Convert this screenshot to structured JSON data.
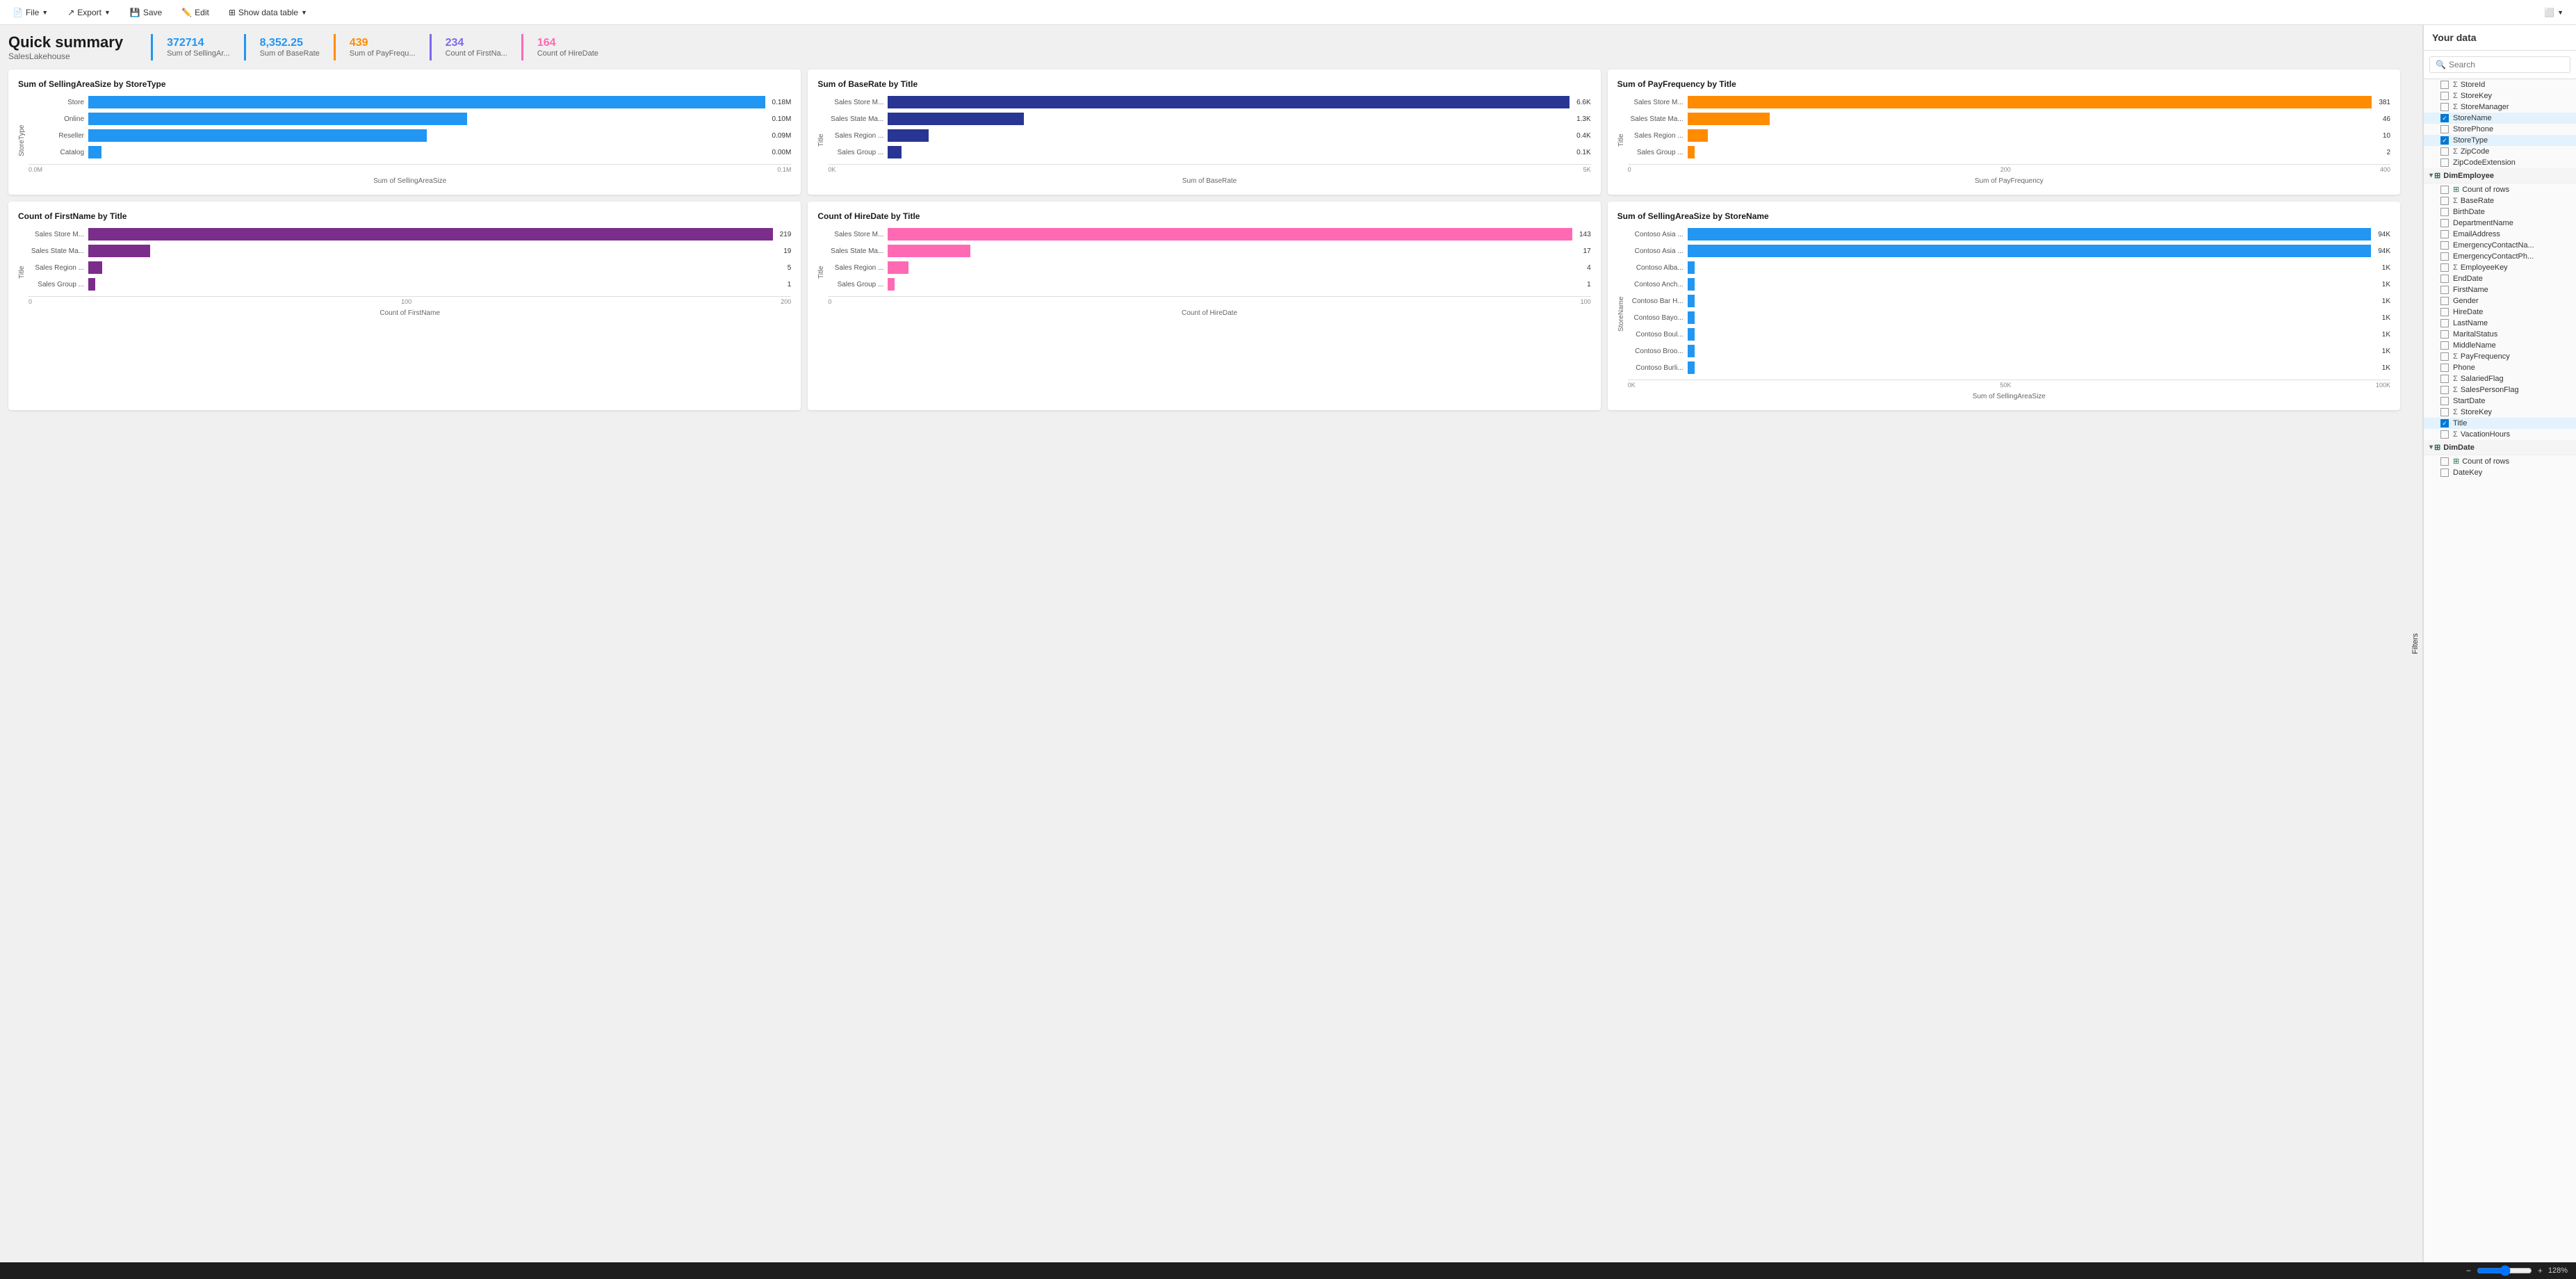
{
  "toolbar": {
    "file_label": "File",
    "export_label": "Export",
    "save_label": "Save",
    "edit_label": "Edit",
    "show_data_table_label": "Show data table"
  },
  "header": {
    "title": "Quick summary",
    "subtitle": "SalesLakehouse"
  },
  "summary_cards": [
    {
      "value": "372714",
      "label": "Sum of SellingAr...",
      "color": "#2196F3"
    },
    {
      "value": "8,352.25",
      "label": "Sum of BaseRate",
      "color": "#2196F3"
    },
    {
      "value": "439",
      "label": "Sum of PayFrequ...",
      "color": "#FF8C00"
    },
    {
      "value": "234",
      "label": "Count of FirstNa...",
      "color": "#7B68EE"
    },
    {
      "value": "164",
      "label": "Count of HireDate",
      "color": "#FF69B4"
    }
  ],
  "charts": [
    {
      "id": "chart1",
      "title": "Sum of SellingAreaSize by StoreType",
      "y_axis": "StoreType",
      "x_axis": "Sum of SellingAreaSize",
      "color": "#2196F3",
      "bars": [
        {
          "label": "Store",
          "value": "0.18M",
          "width_pct": 100
        },
        {
          "label": "Online",
          "value": "0.10M",
          "width_pct": 56
        },
        {
          "label": "Reseller",
          "value": "0.09M",
          "width_pct": 50
        },
        {
          "label": "Catalog",
          "value": "0.00M",
          "width_pct": 2
        }
      ],
      "x_ticks": [
        "0.0M",
        "0.1M"
      ]
    },
    {
      "id": "chart2",
      "title": "Sum of BaseRate by Title",
      "y_axis": "Title",
      "x_axis": "Sum of BaseRate",
      "color": "#283593",
      "bars": [
        {
          "label": "Sales Store M...",
          "value": "6.6K",
          "width_pct": 100
        },
        {
          "label": "Sales State Ma...",
          "value": "1.3K",
          "width_pct": 20
        },
        {
          "label": "Sales Region ...",
          "value": "0.4K",
          "width_pct": 6
        },
        {
          "label": "Sales Group ...",
          "value": "0.1K",
          "width_pct": 2
        }
      ],
      "x_ticks": [
        "0K",
        "5K"
      ]
    },
    {
      "id": "chart3",
      "title": "Sum of PayFrequency by Title",
      "y_axis": "Title",
      "x_axis": "Sum of PayFrequency",
      "color": "#FF8C00",
      "bars": [
        {
          "label": "Sales Store M...",
          "value": "381",
          "width_pct": 100
        },
        {
          "label": "Sales State Ma...",
          "value": "46",
          "width_pct": 12
        },
        {
          "label": "Sales Region ...",
          "value": "10",
          "width_pct": 3
        },
        {
          "label": "Sales Group ...",
          "value": "2",
          "width_pct": 1
        }
      ],
      "x_ticks": [
        "0",
        "200",
        "400"
      ]
    },
    {
      "id": "chart4",
      "title": "Count of FirstName by Title",
      "y_axis": "Title",
      "x_axis": "Count of FirstName",
      "color": "#7B2D8B",
      "bars": [
        {
          "label": "Sales Store M...",
          "value": "219",
          "width_pct": 100
        },
        {
          "label": "Sales State Ma...",
          "value": "19",
          "width_pct": 9
        },
        {
          "label": "Sales Region ...",
          "value": "5",
          "width_pct": 2
        },
        {
          "label": "Sales Group ...",
          "value": "1",
          "width_pct": 0.5
        }
      ],
      "x_ticks": [
        "0",
        "100",
        "200"
      ]
    },
    {
      "id": "chart5",
      "title": "Count of HireDate by Title",
      "y_axis": "Title",
      "x_axis": "Count of HireDate",
      "color": "#FF69B4",
      "bars": [
        {
          "label": "Sales Store M...",
          "value": "143",
          "width_pct": 100
        },
        {
          "label": "Sales State Ma...",
          "value": "17",
          "width_pct": 12
        },
        {
          "label": "Sales Region ...",
          "value": "4",
          "width_pct": 3
        },
        {
          "label": "Sales Group ...",
          "value": "1",
          "width_pct": 0.7
        }
      ],
      "x_ticks": [
        "0",
        "100"
      ]
    },
    {
      "id": "chart6",
      "title": "Sum of SellingAreaSize by StoreName",
      "y_axis": "StoreName",
      "x_axis": "Sum of SellingAreaSize",
      "color": "#2196F3",
      "bars": [
        {
          "label": "Contoso Asia ...",
          "value": "94K",
          "width_pct": 100
        },
        {
          "label": "Contoso Asia ...",
          "value": "94K",
          "width_pct": 100
        },
        {
          "label": "Contoso Alba...",
          "value": "1K",
          "width_pct": 1
        },
        {
          "label": "Contoso Anch...",
          "value": "1K",
          "width_pct": 1
        },
        {
          "label": "Contoso Bar H...",
          "value": "1K",
          "width_pct": 1
        },
        {
          "label": "Contoso Bayo...",
          "value": "1K",
          "width_pct": 1
        },
        {
          "label": "Contoso Boul...",
          "value": "1K",
          "width_pct": 1
        },
        {
          "label": "Contoso Broo...",
          "value": "1K",
          "width_pct": 1
        },
        {
          "label": "Contoso Burli...",
          "value": "1K",
          "width_pct": 1
        }
      ],
      "x_ticks": [
        "0K",
        "50K",
        "100K"
      ]
    }
  ],
  "right_panel": {
    "title": "Your data",
    "search_placeholder": "Search",
    "filters_label": "Filters",
    "tree_items": [
      {
        "type": "item",
        "text": "StoreId",
        "icon": "sigma",
        "indent": 1,
        "checked": false
      },
      {
        "type": "item",
        "text": "StoreKey",
        "icon": "sigma",
        "indent": 1,
        "checked": false
      },
      {
        "type": "item",
        "text": "StoreManager",
        "icon": "sigma",
        "indent": 1,
        "checked": false
      },
      {
        "type": "item",
        "text": "StoreName",
        "icon": "",
        "indent": 1,
        "checked": true,
        "selected": true
      },
      {
        "type": "item",
        "text": "StorePhone",
        "icon": "",
        "indent": 1,
        "checked": false
      },
      {
        "type": "item",
        "text": "StoreType",
        "icon": "",
        "indent": 1,
        "checked": true,
        "selected": true
      },
      {
        "type": "item",
        "text": "ZipCode",
        "icon": "sigma",
        "indent": 1,
        "checked": false
      },
      {
        "type": "item",
        "text": "ZipCodeExtension",
        "icon": "",
        "indent": 1,
        "checked": false
      },
      {
        "type": "section",
        "text": "DimEmployee",
        "indent": 0,
        "expanded": true
      },
      {
        "type": "item",
        "text": "Count of rows",
        "icon": "table",
        "indent": 1,
        "checked": false
      },
      {
        "type": "item",
        "text": "BaseRate",
        "icon": "sigma",
        "indent": 1,
        "checked": false
      },
      {
        "type": "item",
        "text": "BirthDate",
        "icon": "",
        "indent": 1,
        "checked": false
      },
      {
        "type": "item",
        "text": "DepartmentName",
        "icon": "",
        "indent": 1,
        "checked": false
      },
      {
        "type": "item",
        "text": "EmailAddress",
        "icon": "",
        "indent": 1,
        "checked": false
      },
      {
        "type": "item",
        "text": "EmergencyContactNa...",
        "icon": "",
        "indent": 1,
        "checked": false
      },
      {
        "type": "item",
        "text": "EmergencyContactPh...",
        "icon": "",
        "indent": 1,
        "checked": false
      },
      {
        "type": "item",
        "text": "EmployeeKey",
        "icon": "sigma",
        "indent": 1,
        "checked": false
      },
      {
        "type": "item",
        "text": "EndDate",
        "icon": "",
        "indent": 1,
        "checked": false
      },
      {
        "type": "item",
        "text": "FirstName",
        "icon": "",
        "indent": 1,
        "checked": false
      },
      {
        "type": "item",
        "text": "Gender",
        "icon": "",
        "indent": 1,
        "checked": false
      },
      {
        "type": "item",
        "text": "HireDate",
        "icon": "",
        "indent": 1,
        "checked": false
      },
      {
        "type": "item",
        "text": "LastName",
        "icon": "",
        "indent": 1,
        "checked": false
      },
      {
        "type": "item",
        "text": "MaritalStatus",
        "icon": "",
        "indent": 1,
        "checked": false
      },
      {
        "type": "item",
        "text": "MiddleName",
        "icon": "",
        "indent": 1,
        "checked": false
      },
      {
        "type": "item",
        "text": "PayFrequency",
        "icon": "sigma",
        "indent": 1,
        "checked": false
      },
      {
        "type": "item",
        "text": "Phone",
        "icon": "",
        "indent": 1,
        "checked": false
      },
      {
        "type": "item",
        "text": "SalariedFlag",
        "icon": "sigma",
        "indent": 1,
        "checked": false
      },
      {
        "type": "item",
        "text": "SalesPersonFlag",
        "icon": "sigma",
        "indent": 1,
        "checked": false
      },
      {
        "type": "item",
        "text": "StartDate",
        "icon": "",
        "indent": 1,
        "checked": false
      },
      {
        "type": "item",
        "text": "StoreKey",
        "icon": "sigma",
        "indent": 1,
        "checked": false
      },
      {
        "type": "item",
        "text": "Title",
        "icon": "",
        "indent": 1,
        "checked": true,
        "selected": true
      },
      {
        "type": "item",
        "text": "VacationHours",
        "icon": "sigma",
        "indent": 1,
        "checked": false
      },
      {
        "type": "section",
        "text": "DimDate",
        "indent": 0,
        "expanded": true
      },
      {
        "type": "item",
        "text": "Count of rows",
        "icon": "table",
        "indent": 1,
        "checked": false
      },
      {
        "type": "item",
        "text": "DateKey",
        "icon": "",
        "indent": 1,
        "checked": false
      }
    ]
  },
  "status_bar": {
    "zoom_level": "128%"
  }
}
